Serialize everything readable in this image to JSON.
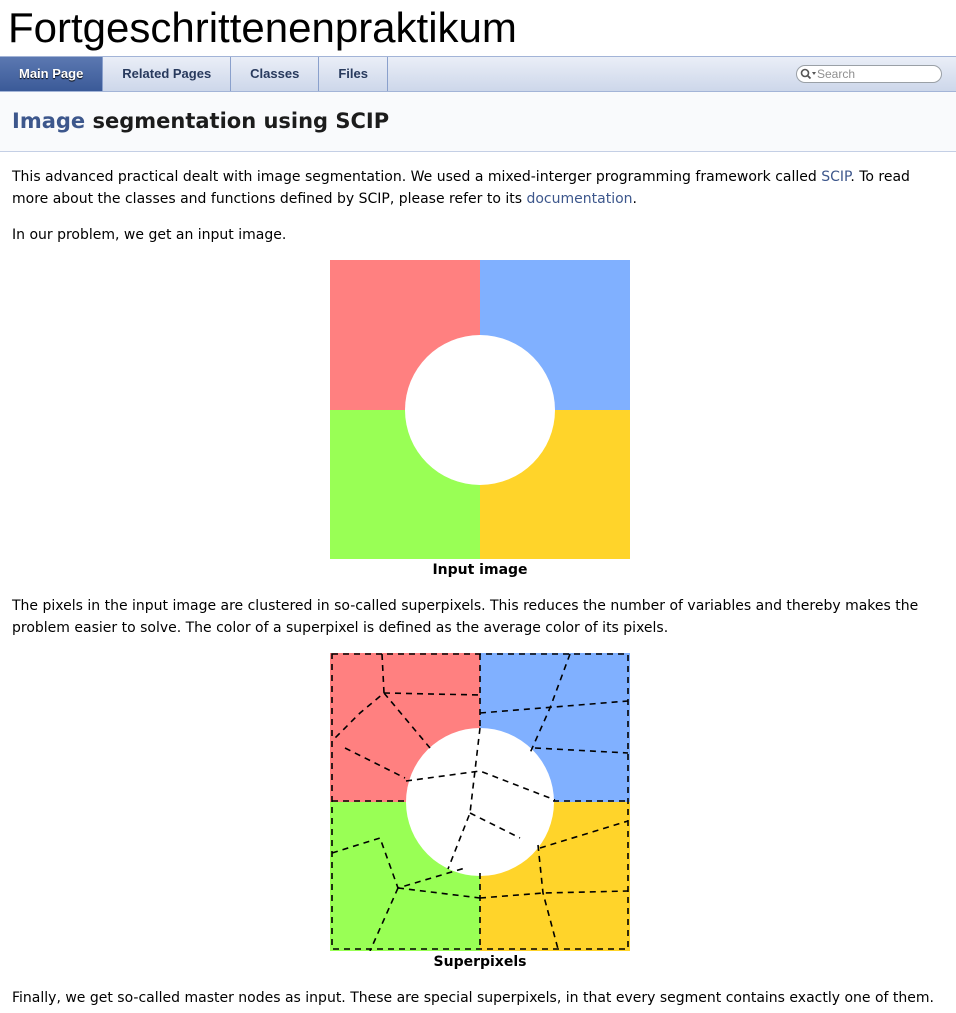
{
  "project": {
    "title": "Fortgeschrittenenpraktikum"
  },
  "nav": {
    "tabs": [
      {
        "label": "Main Page",
        "active": true
      },
      {
        "label": "Related Pages",
        "active": false
      },
      {
        "label": "Classes",
        "active": false
      },
      {
        "label": "Files",
        "active": false
      }
    ],
    "search": {
      "placeholder": "Search"
    }
  },
  "page": {
    "title_highlight": "Image",
    "title_rest": " segmentation using SCIP"
  },
  "content": {
    "p1_a": "This advanced practical dealt with image segmentation. We used a mixed-interger programming framework called ",
    "p1_link1": "SCIP",
    "p1_b": ". To read more about the classes and functions defined by SCIP, please refer to its ",
    "p1_link2": "documentation",
    "p1_c": ".",
    "p2": "In our problem, we get an input image.",
    "fig1_caption": "Input image",
    "p3": "The pixels in the input image are clustered in so-called superpixels. This reduces the number of variables and thereby makes the problem easier to solve. The color of a superpixel is defined as the average color of its pixels.",
    "fig2_caption": "Superpixels",
    "p4": "Finally, we get so-called master nodes as input. These are special superpixels, in that every segment contains exactly one of them."
  },
  "colors": {
    "red": "#ff8080",
    "blue": "#80b0ff",
    "green": "#99ff55",
    "yellow": "#ffd42a",
    "accent": "#3d578c"
  }
}
